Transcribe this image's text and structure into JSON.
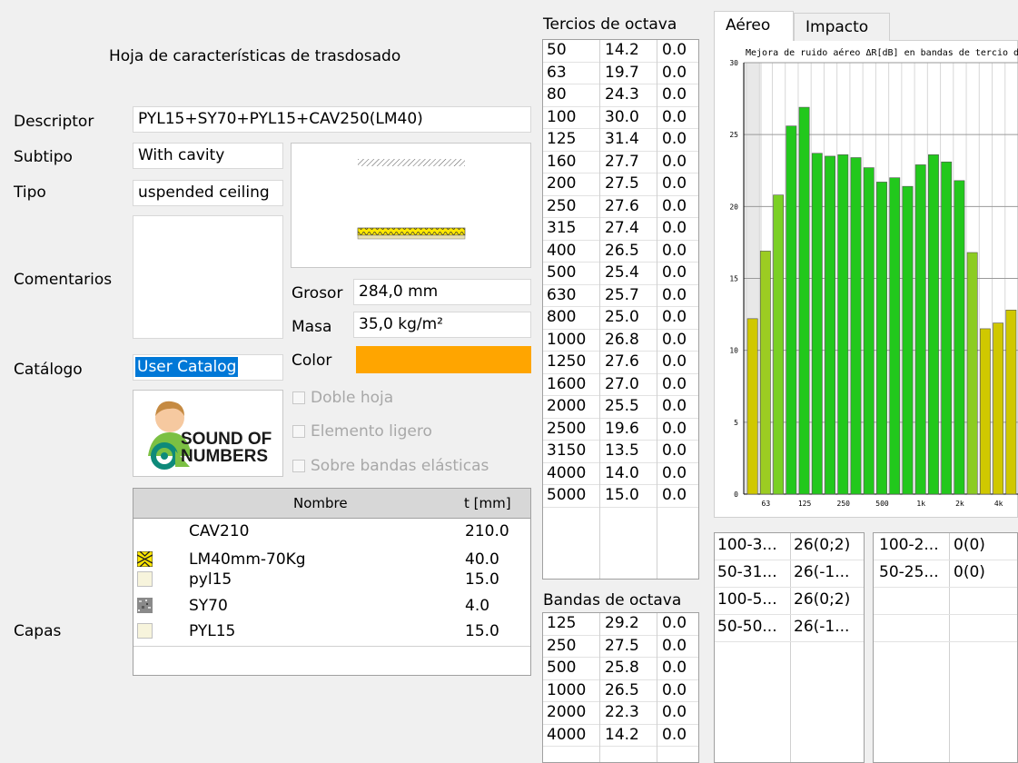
{
  "title": "Hoja de características de trasdosado",
  "form": {
    "descriptor_label": "Descriptor",
    "descriptor_value": "PYL15+SY70+PYL15+CAV250(LM40)",
    "subtipo_label": "Subtipo",
    "subtipo_value": "With cavity",
    "tipo_label": "Tipo",
    "tipo_value": "uspended ceiling",
    "comentarios_label": "Comentarios",
    "grosor_label": "Grosor",
    "grosor_value": "284,0 mm",
    "masa_label": "Masa",
    "masa_value": "35,0 kg/m²",
    "color_label": "Color",
    "color_value": "#ffa500",
    "catalogo_label": "Catálogo",
    "catalogo_value": "User Catalog",
    "capas_label": "Capas"
  },
  "logo": {
    "line1": "SOUND OF",
    "line2": "NUMBERS"
  },
  "checkboxes": [
    {
      "label": "Doble hoja",
      "checked": false
    },
    {
      "label": "Elemento ligero",
      "checked": false
    },
    {
      "label": "Sobre bandas elásticas",
      "checked": false
    }
  ],
  "layers": {
    "col_name": "Nombre",
    "col_t": "t [mm]",
    "rows": [
      {
        "swatch": "none",
        "name": "CAV210",
        "t": "210.0"
      },
      {
        "swatch": "insulation",
        "name": "LM40mm-70Kg",
        "t": "40.0"
      },
      {
        "swatch": "plaster",
        "name": "pyl15",
        "t": "15.0"
      },
      {
        "swatch": "stone",
        "name": "SY70",
        "t": "4.0"
      },
      {
        "swatch": "plaster",
        "name": "PYL15",
        "t": "15.0"
      }
    ]
  },
  "tercios": {
    "title": "Tercios de octava",
    "rows": [
      [
        "50",
        "14.2",
        "0.0"
      ],
      [
        "63",
        "19.7",
        "0.0"
      ],
      [
        "80",
        "24.3",
        "0.0"
      ],
      [
        "100",
        "30.0",
        "0.0"
      ],
      [
        "125",
        "31.4",
        "0.0"
      ],
      [
        "160",
        "27.7",
        "0.0"
      ],
      [
        "200",
        "27.5",
        "0.0"
      ],
      [
        "250",
        "27.6",
        "0.0"
      ],
      [
        "315",
        "27.4",
        "0.0"
      ],
      [
        "400",
        "26.5",
        "0.0"
      ],
      [
        "500",
        "25.4",
        "0.0"
      ],
      [
        "630",
        "25.7",
        "0.0"
      ],
      [
        "800",
        "25.0",
        "0.0"
      ],
      [
        "1000",
        "26.8",
        "0.0"
      ],
      [
        "1250",
        "27.6",
        "0.0"
      ],
      [
        "1600",
        "27.0",
        "0.0"
      ],
      [
        "2000",
        "25.5",
        "0.0"
      ],
      [
        "2500",
        "19.6",
        "0.0"
      ],
      [
        "3150",
        "13.5",
        "0.0"
      ],
      [
        "4000",
        "14.0",
        "0.0"
      ],
      [
        "5000",
        "15.0",
        "0.0"
      ]
    ]
  },
  "octavas": {
    "title": "Bandas de octava",
    "rows": [
      [
        "125",
        "29.2",
        "0.0"
      ],
      [
        "250",
        "27.5",
        "0.0"
      ],
      [
        "500",
        "25.8",
        "0.0"
      ],
      [
        "1000",
        "26.5",
        "0.0"
      ],
      [
        "2000",
        "22.3",
        "0.0"
      ],
      [
        "4000",
        "14.2",
        "0.0"
      ]
    ]
  },
  "tabs": [
    {
      "label": "Aéreo",
      "active": true
    },
    {
      "label": "Impacto",
      "active": false
    }
  ],
  "results_left": [
    [
      "100-3...",
      "26(0;2)"
    ],
    [
      "50-31...",
      "26(-1..."
    ],
    [
      "100-5...",
      "26(0;2)"
    ],
    [
      "50-50...",
      "26(-1..."
    ]
  ],
  "results_right": [
    [
      "100-2...",
      "0(0)"
    ],
    [
      "50-25...",
      "0(0)"
    ]
  ],
  "chart_data": {
    "type": "bar",
    "title": "Mejora de ruido aéreo ΔR[dB] en bandas de tercio d",
    "x_tick_labels": [
      "63",
      "125",
      "250",
      "500",
      "1k",
      "2k",
      "4k"
    ],
    "ylim": [
      0,
      30
    ],
    "yticks": [
      "0",
      "5",
      "10",
      "15",
      "20",
      "25",
      "30"
    ],
    "grid": true,
    "values": [
      12.2,
      16.9,
      20.8,
      25.6,
      26.9,
      23.7,
      23.5,
      23.6,
      23.4,
      22.7,
      21.7,
      22.0,
      21.4,
      22.9,
      23.6,
      23.1,
      21.8,
      16.8,
      11.5,
      11.9,
      12.8
    ],
    "bar_colors": [
      "#d0c800",
      "#9ccc22",
      "#7ad024",
      "#22c81c",
      "#22c81c",
      "#22c81c",
      "#22c81c",
      "#22c81c",
      "#22c81c",
      "#22c81c",
      "#22c81c",
      "#22c81c",
      "#22c81c",
      "#22c81c",
      "#22c81c",
      "#22c81c",
      "#22c81c",
      "#8ccc22",
      "#d0c800",
      "#d0c800",
      "#d0c800"
    ]
  }
}
